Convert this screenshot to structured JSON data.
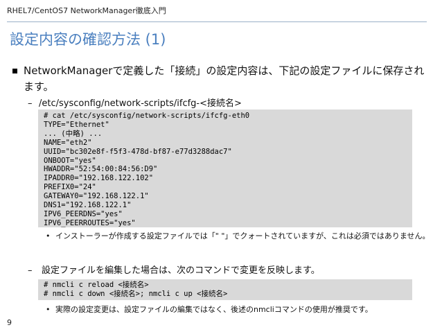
{
  "header": {
    "text": "RHEL7/CentOS7 NetworkManager徹底入門"
  },
  "title": "設定内容の確認方法 (1)",
  "bullet": {
    "text": "NetworkManagerで定義した「接続」の設定内容は、下記の設定ファイルに保存されます。"
  },
  "sub1": {
    "dash": "–",
    "text": "/etc/sysconfig/network-scripts/ifcfg-<接続名>"
  },
  "code1": {
    "lines": [
      "# cat /etc/sysconfig/network-scripts/ifcfg-eth0",
      "TYPE=\"Ethernet\"",
      "... (中略) ...",
      "NAME=\"eth2\"",
      "UUID=\"bc302e8f-f5f3-478d-bf87-e77d3288dac7\"",
      "ONBOOT=\"yes\"",
      "HWADDR=\"52:54:00:84:56:D9\"",
      "IPADDR0=\"192.168.122.102\"",
      "PREFIX0=\"24\"",
      "GATEWAY0=\"192.168.122.1\"",
      "DNS1=\"192.168.122.1\"",
      "IPV6_PEERDNS=\"yes\"",
      "IPV6_PEERROUTES=\"yes\""
    ]
  },
  "note1": {
    "dot": "•",
    "text": "インストーラーが作成する設定ファイルでは「\" \"」でクォートされていますが、これは必須ではありません。"
  },
  "sub2": {
    "dash": "–",
    "text": "設定ファイルを編集した場合は、次のコマンドで変更を反映します。"
  },
  "code2": {
    "lines": [
      "# nmcli c reload <接続名>",
      "# nmcli c down <接続名>; nmcli c up <接続名>"
    ]
  },
  "note2": {
    "dot": "•",
    "text": "実際の設定変更は、設定ファイルの編集ではなく、後述のnmcliコマンドの使用が推奨です。"
  },
  "page_number": "9"
}
